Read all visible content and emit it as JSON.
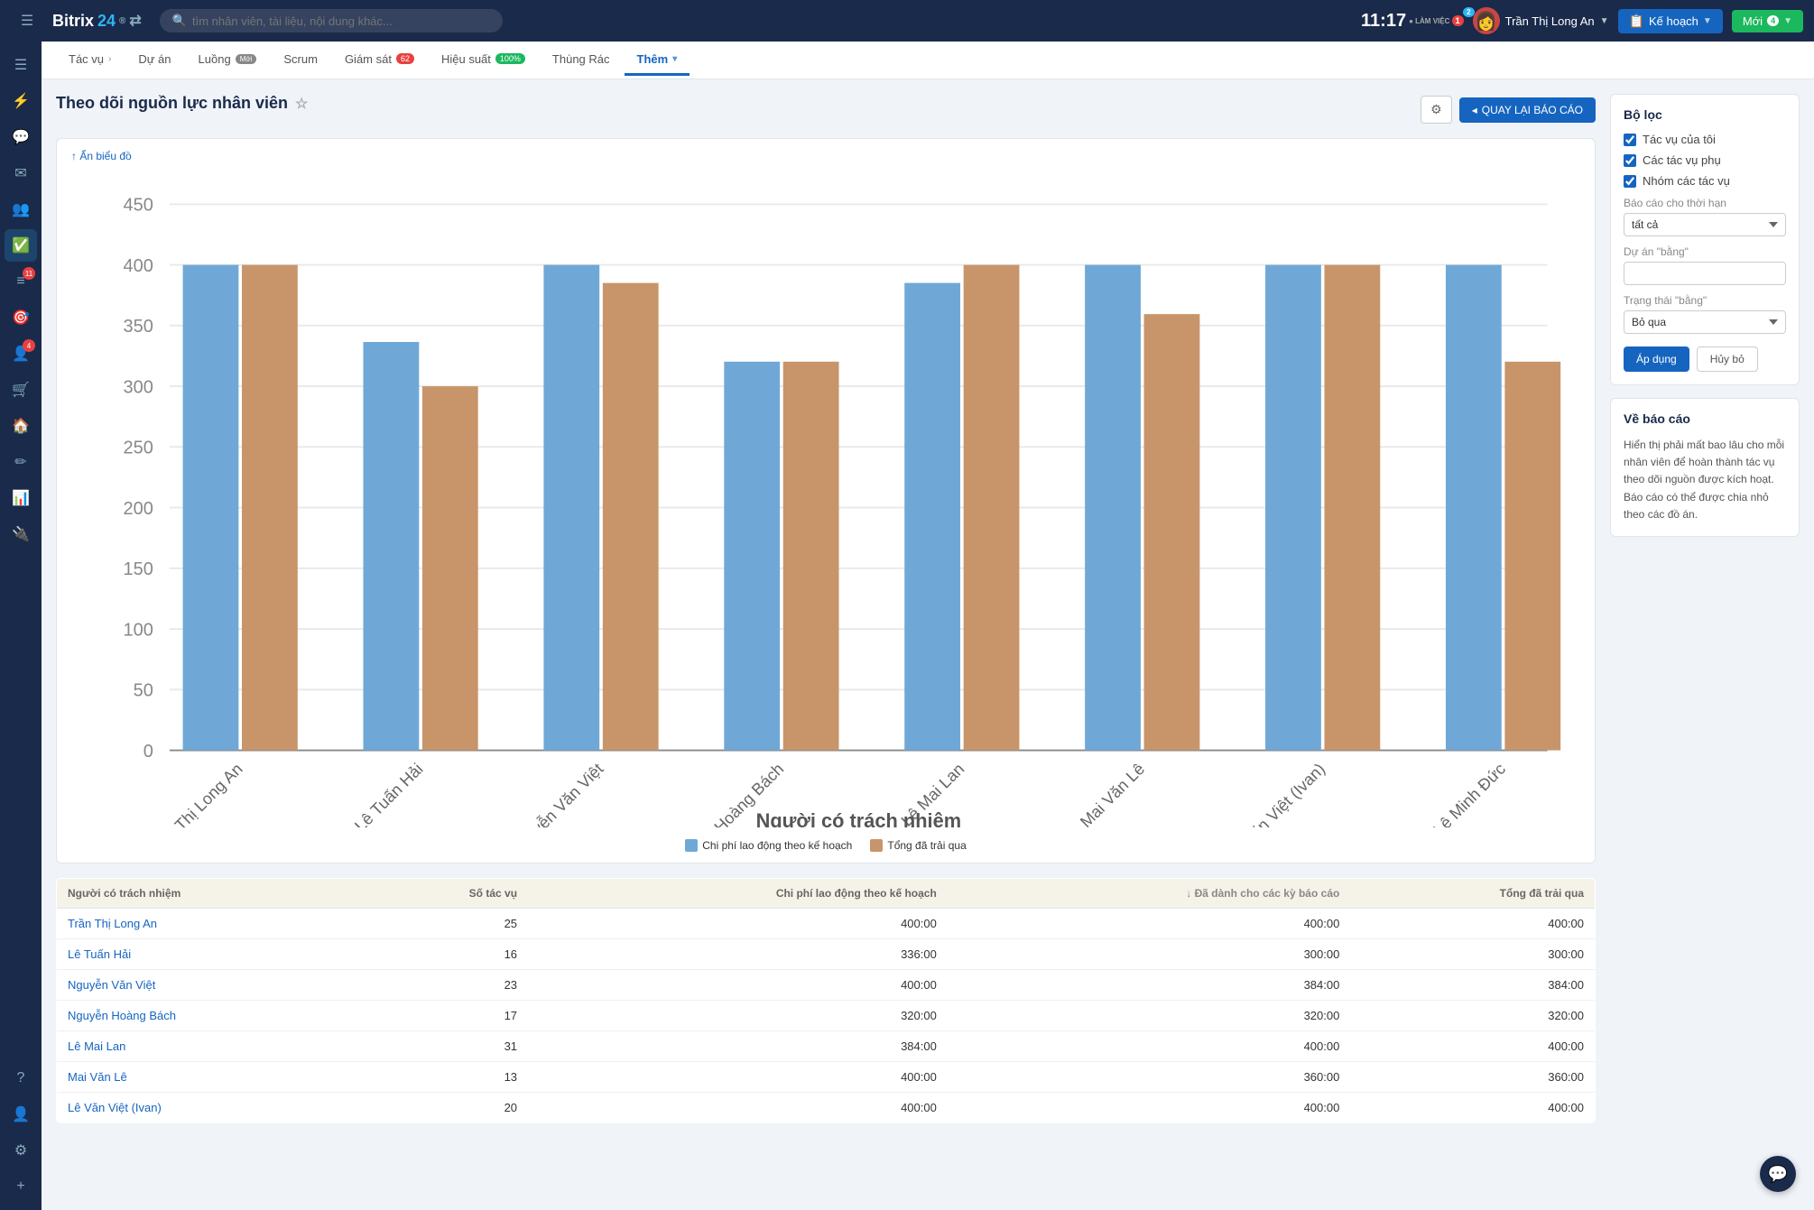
{
  "app": {
    "name": "Bitrix",
    "name_colored": "24"
  },
  "topbar": {
    "time": "11:17",
    "work_label": "LÀM VIỆC",
    "work_badge": "1",
    "notification_badge": "2",
    "search_placeholder": "tìm nhân viên, tài liệu, nội dung khác...",
    "user_name": "Trần Thị Long An",
    "btn_plan": "Kế hoạch",
    "btn_new": "Mới",
    "btn_new_badge": "4"
  },
  "sidebar": {
    "icons": [
      "☰",
      "⚡",
      "💬",
      "📧",
      "👥",
      "✅",
      "≡",
      "🎯",
      "👤",
      "🛒",
      "🏠",
      "✏️",
      "📊",
      "🔌",
      "?",
      "👤",
      "⚙️",
      "+"
    ]
  },
  "tabs": [
    {
      "id": "tasks",
      "label": "Tác vụ",
      "has_arrow": true
    },
    {
      "id": "projects",
      "label": "Dự án"
    },
    {
      "id": "luong",
      "label": "Luồng",
      "badge": "Mới",
      "badge_type": "new"
    },
    {
      "id": "scrum",
      "label": "Scrum"
    },
    {
      "id": "giam_sat",
      "label": "Giám sát",
      "badge": "62",
      "badge_type": "red"
    },
    {
      "id": "hieu_suat",
      "label": "Hiệu suất",
      "badge": "100%",
      "badge_type": "green"
    },
    {
      "id": "thung_rac",
      "label": "Thùng Rác"
    },
    {
      "id": "them",
      "label": "Thêm",
      "active": true,
      "has_arrow": true
    }
  ],
  "page": {
    "title": "Theo dõi nguồn lực nhân viên",
    "chart_toggle": "↑ Ẩn biểu đồ",
    "chart_x_label": "Người có trách nhiệm",
    "btn_settings_label": "⚙",
    "btn_back_label": "QUAY LẠI BÁO CÁO"
  },
  "chart": {
    "y_labels": [
      "0",
      "50",
      "100",
      "150",
      "200",
      "250",
      "300",
      "350",
      "400",
      "450"
    ],
    "bars": [
      {
        "name": "Trần Thị Long An",
        "planned": 400,
        "actual": 400
      },
      {
        "name": "Lê Tuấn Hải",
        "planned": 336,
        "actual": 300
      },
      {
        "name": "Nguyễn Văn Việt",
        "planned": 400,
        "actual": 384
      },
      {
        "name": "Nguyễn Hoàng Bách",
        "planned": 320,
        "actual": 320
      },
      {
        "name": "Lê Mai Lan",
        "planned": 384,
        "actual": 400
      },
      {
        "name": "Mai Văn Lê",
        "planned": 400,
        "actual": 360
      },
      {
        "name": "Lê Văn Việt (Ivan)",
        "planned": 400,
        "actual": 400
      },
      {
        "name": "Lê Minh Đức",
        "planned": 400,
        "actual": 320
      }
    ],
    "legend": [
      {
        "label": "Chi phí lao động theo kế hoạch",
        "color": "#6fa8d6"
      },
      {
        "label": "Tổng đã trải qua",
        "color": "#c8956a"
      }
    ],
    "max_value": 450
  },
  "table": {
    "headers": [
      "Người có trách nhiệm",
      "Số tác vụ",
      "Chi phí lao động theo kế hoạch",
      "↓ Đã dành cho các kỳ báo cáo",
      "Tổng đã trải qua"
    ],
    "rows": [
      {
        "name": "Trần Thị Long An",
        "tasks": 25,
        "planned": "400:00",
        "period": "400:00",
        "actual": "400:00"
      },
      {
        "name": "Lê Tuấn Hải",
        "tasks": 16,
        "planned": "336:00",
        "period": "300:00",
        "actual": "300:00"
      },
      {
        "name": "Nguyễn Văn Việt",
        "tasks": 23,
        "planned": "400:00",
        "period": "384:00",
        "actual": "384:00"
      },
      {
        "name": "Nguyễn Hoàng Bách",
        "tasks": 17,
        "planned": "320:00",
        "period": "320:00",
        "actual": "320:00"
      },
      {
        "name": "Lê Mai Lan",
        "tasks": 31,
        "planned": "384:00",
        "period": "400:00",
        "actual": "400:00"
      },
      {
        "name": "Mai Văn Lê",
        "tasks": 13,
        "planned": "400:00",
        "period": "360:00",
        "actual": "360:00"
      },
      {
        "name": "Lê Văn Việt (Ivan)",
        "tasks": 20,
        "planned": "400:00",
        "period": "400:00",
        "actual": "400:00"
      }
    ]
  },
  "filter": {
    "title": "Bộ lọc",
    "checkbox1": "Tác vụ của tôi",
    "checkbox2": "Các tác vụ phụ",
    "checkbox3": "Nhóm các tác vụ",
    "time_label": "Báo cáo cho thời hạn",
    "time_value": "tất cả",
    "project_label": "Dự án \"bằng\"",
    "project_placeholder": "",
    "status_label": "Trạng thái \"bằng\"",
    "status_value": "Bỏ qua",
    "btn_apply": "Áp dụng",
    "btn_cancel": "Hủy bỏ"
  },
  "about": {
    "title": "Về báo cáo",
    "text": "Hiển thị phải mất bao lâu cho mỗi nhân viên để hoàn thành tác vụ theo dõi nguồn được kích hoạt. Báo cáo có thể được chia nhỏ theo các đồ án."
  }
}
